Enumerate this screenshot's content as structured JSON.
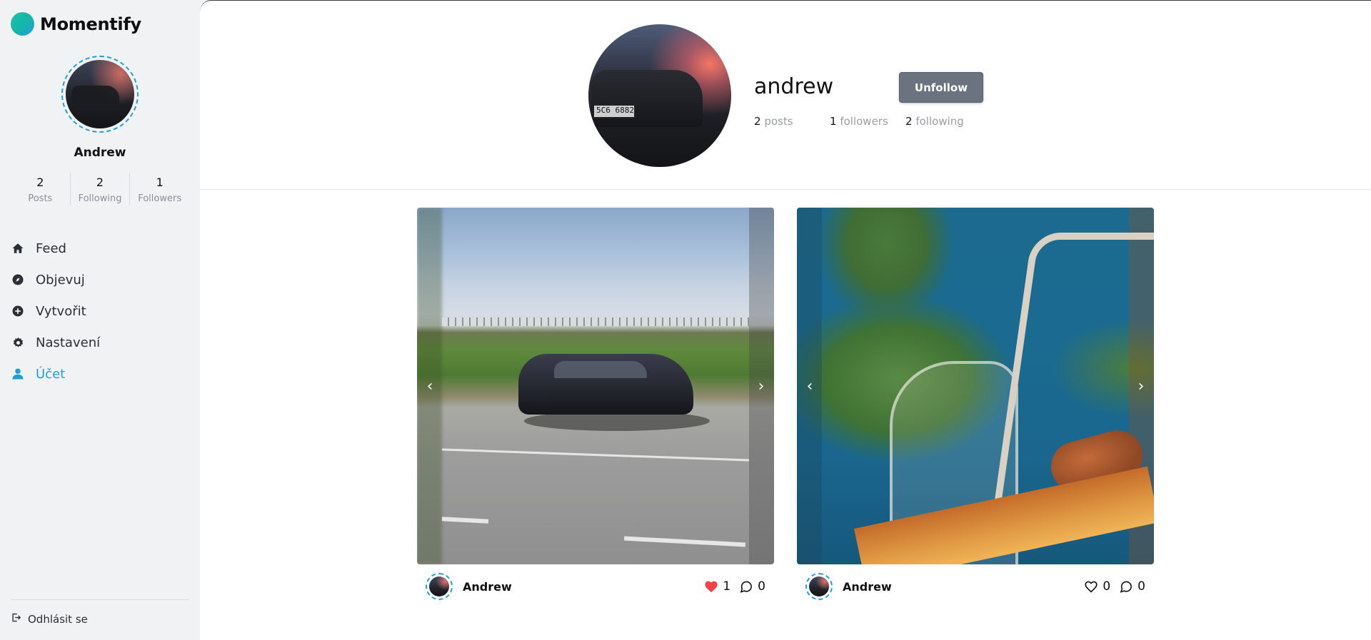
{
  "app": {
    "name": "Momentify"
  },
  "sidebar": {
    "username": "Andrew",
    "stats": [
      {
        "value": "2",
        "label": "Posts"
      },
      {
        "value": "2",
        "label": "Following"
      },
      {
        "value": "1",
        "label": "Followers"
      }
    ],
    "nav": [
      {
        "label": "Feed",
        "icon": "home-icon",
        "active": false
      },
      {
        "label": "Objevuj",
        "icon": "compass-icon",
        "active": false
      },
      {
        "label": "Vytvořit",
        "icon": "plus-circle-icon",
        "active": false
      },
      {
        "label": "Nastavení",
        "icon": "gear-icon",
        "active": false
      },
      {
        "label": "Účet",
        "icon": "user-icon",
        "active": true
      }
    ],
    "logout_label": "Odhlásit se"
  },
  "profile": {
    "name": "andrew",
    "unfollow_label": "Unfollow",
    "avatar_plate_text": "5C6 6882",
    "stats": {
      "posts_count": "2",
      "posts_label": "posts",
      "followers_count": "1",
      "followers_label": "followers",
      "following_count": "2",
      "following_label": "following"
    }
  },
  "posts": [
    {
      "author": "Andrew",
      "likes": "1",
      "liked": true,
      "comments": "0",
      "image": "car-photo"
    },
    {
      "author": "Andrew",
      "likes": "0",
      "liked": false,
      "comments": "0",
      "image": "anime-sea-view"
    }
  ],
  "colors": {
    "accent": "#1ea1d8",
    "like_red": "#ef4444",
    "button_gray": "#6b7280",
    "sidebar_bg": "#f1f2f4"
  },
  "carousel": {
    "prev_glyph": "‹",
    "next_glyph": "›"
  }
}
